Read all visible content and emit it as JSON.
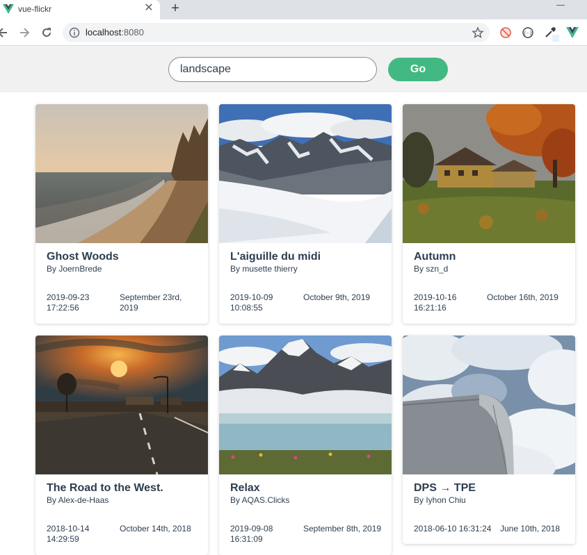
{
  "browser": {
    "tab_title": "vue-flickr",
    "url_host": "localhost",
    "url_port": ":8080"
  },
  "search": {
    "value": "landscape",
    "button_label": "Go",
    "accent_color": "#42b983"
  },
  "photos": [
    {
      "title": "Ghost Woods",
      "author": "By JoernBrede",
      "taken": "2019-09-23 17:22:56",
      "date_text": "September 23rd, 2019",
      "image": "beach-cliff"
    },
    {
      "title": "L'aiguille du midi",
      "author": "By musette thierry",
      "taken": "2019-10-09 10:08:55",
      "date_text": "October 9th, 2019",
      "image": "snowy-mountains"
    },
    {
      "title": "Autumn",
      "author": "By szn_d",
      "taken": "2019-10-16 16:21:16",
      "date_text": "October 16th, 2019",
      "image": "autumn-house"
    },
    {
      "title": "The Road to the West.",
      "author": "By Alex-de-Haas",
      "taken": "2018-10-14 14:29:59",
      "date_text": "October 14th, 2018",
      "image": "sunset-road"
    },
    {
      "title": "Relax",
      "author": "By AQAS.Clicks",
      "taken": "2019-09-08 16:31:09",
      "date_text": "September 8th, 2019",
      "image": "mountain-lake"
    },
    {
      "title": "DPS → TPE",
      "author": "By Iyhon Chiu",
      "taken": "2018-06-10 16:31:24",
      "date_text": "June 10th, 2018",
      "image": "clouds-engine"
    }
  ]
}
